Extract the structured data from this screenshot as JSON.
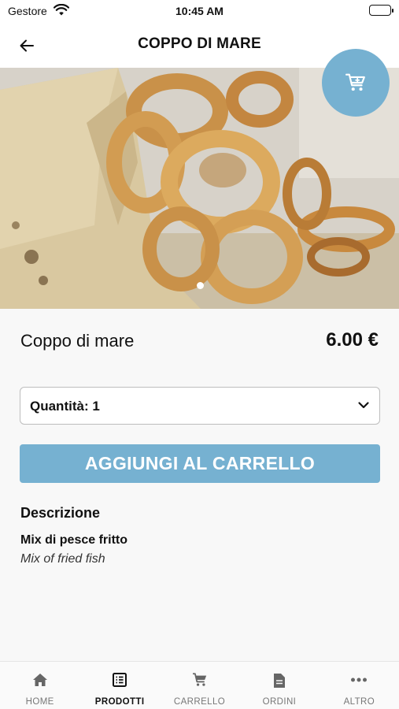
{
  "status_bar": {
    "carrier": "Gestore",
    "time": "10:45 AM"
  },
  "header": {
    "title": "COPPO DI MARE",
    "back_icon": "arrow-left-icon",
    "cart_icon": "cart-icon"
  },
  "carousel": {
    "image_alt": "Fried calamari rings in a paper cone",
    "pages": 1,
    "active_page": 1
  },
  "product": {
    "name": "Coppo di mare",
    "price": "6.00 €",
    "quantity_label": "Quantità: 1",
    "add_button_label": "AGGIUNGI AL CARRELLO",
    "description_heading": "Descrizione",
    "description_title": "Mix di pesce fritto",
    "description_subtitle": "Mix of fried fish"
  },
  "tabs": [
    {
      "label": "HOME",
      "icon": "home-icon",
      "active": false
    },
    {
      "label": "PRODOTTI",
      "icon": "list-icon",
      "active": true
    },
    {
      "label": "CARRELLO",
      "icon": "cart-icon",
      "active": false
    },
    {
      "label": "ORDINI",
      "icon": "document-icon",
      "active": false
    },
    {
      "label": "ALTRO",
      "icon": "more-icon",
      "active": false
    }
  ],
  "colors": {
    "accent": "#76b1d1",
    "background": "#f8f8f8",
    "text": "#111111"
  }
}
